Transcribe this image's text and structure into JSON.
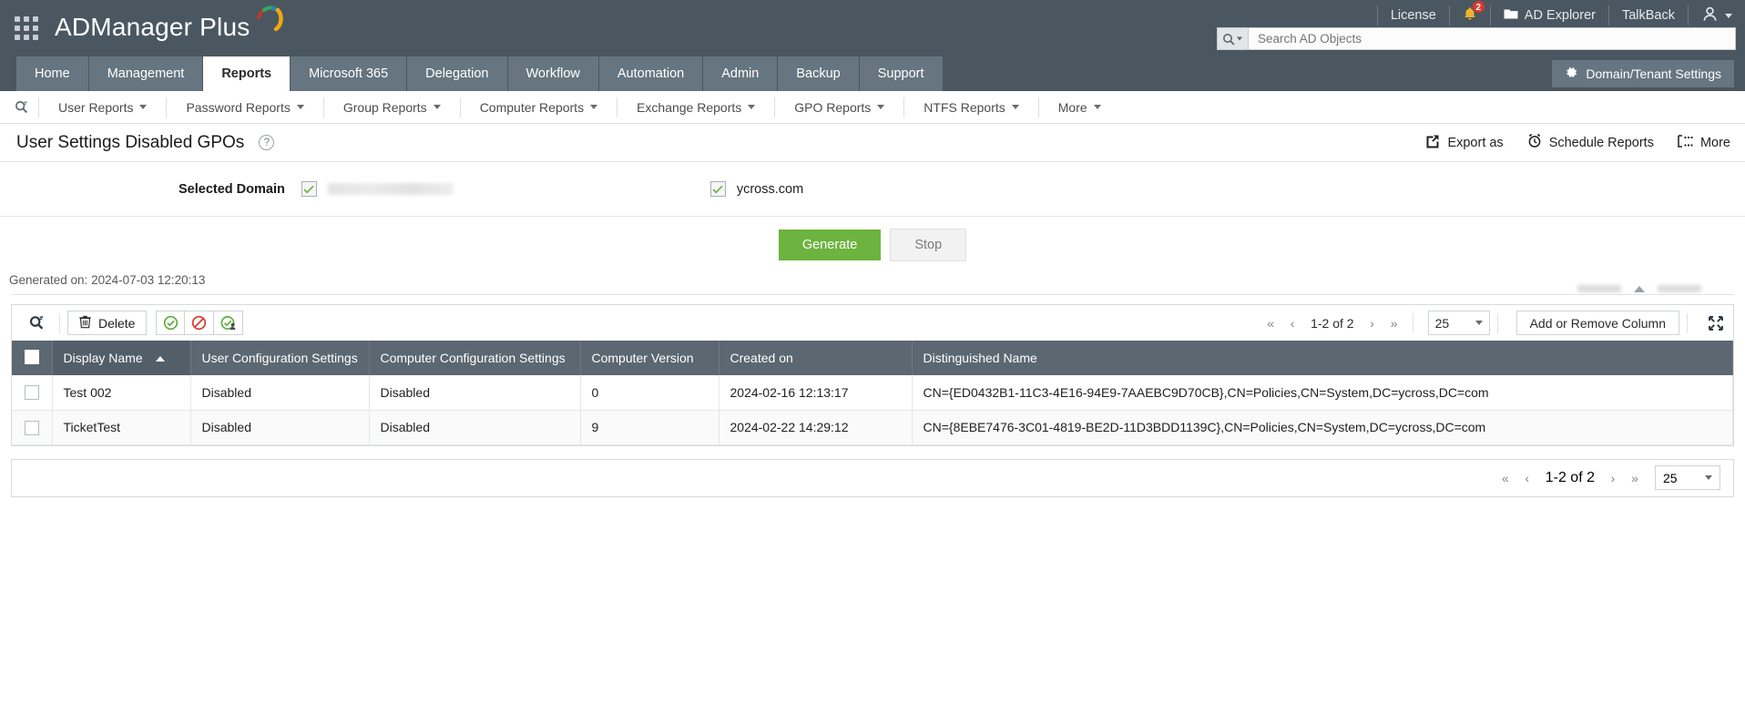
{
  "header": {
    "brand": "ADManager Plus",
    "apps_icon": "apps-grid-icon",
    "license_label": "License",
    "notification_count": "2",
    "ad_explorer_label": "AD Explorer",
    "talkback_label": "TalkBack",
    "search": {
      "placeholder": "Search AD Objects",
      "value": ""
    }
  },
  "nav": {
    "tabs": [
      {
        "label": "Home",
        "active": false
      },
      {
        "label": "Management",
        "active": false
      },
      {
        "label": "Reports",
        "active": true
      },
      {
        "label": "Microsoft 365",
        "active": false
      },
      {
        "label": "Delegation",
        "active": false
      },
      {
        "label": "Workflow",
        "active": false
      },
      {
        "label": "Automation",
        "active": false
      },
      {
        "label": "Admin",
        "active": false
      },
      {
        "label": "Backup",
        "active": false
      },
      {
        "label": "Support",
        "active": false
      }
    ],
    "domain_tenant_settings": "Domain/Tenant Settings"
  },
  "subnav": {
    "items": [
      {
        "label": "User Reports"
      },
      {
        "label": "Password Reports"
      },
      {
        "label": "Group Reports"
      },
      {
        "label": "Computer Reports"
      },
      {
        "label": "Exchange Reports"
      },
      {
        "label": "GPO Reports"
      },
      {
        "label": "NTFS Reports"
      },
      {
        "label": "More"
      }
    ]
  },
  "page": {
    "title": "User Settings Disabled GPOs",
    "help": "?",
    "actions": {
      "export_as": "Export as",
      "schedule_reports": "Schedule Reports",
      "more": "More"
    }
  },
  "domain_selector": {
    "label": "Selected Domain",
    "domains": [
      {
        "name": "",
        "redacted": true,
        "checked": true
      },
      {
        "name": "ycross.com",
        "redacted": false,
        "checked": true
      }
    ]
  },
  "actions": {
    "generate": "Generate",
    "stop": "Stop"
  },
  "generated_on": "Generated on: 2024-07-03 12:20:13",
  "toolbar": {
    "delete_label": "Delete",
    "add_remove_column": "Add or Remove Column",
    "page_size": "25",
    "page_range": "1-2 of 2"
  },
  "bottom_toolbar": {
    "page_range": "1-2 of 2",
    "page_size": "25"
  },
  "table": {
    "columns": [
      {
        "label": "Display Name",
        "sorted": true,
        "sort_dir": "asc"
      },
      {
        "label": "User Configuration Settings",
        "sorted": false
      },
      {
        "label": "Computer Configuration Settings",
        "sorted": false
      },
      {
        "label": "Computer Version",
        "sorted": false
      },
      {
        "label": "Created on",
        "sorted": false
      },
      {
        "label": "Distinguished Name",
        "sorted": false
      }
    ],
    "rows": [
      {
        "display_name": "Test 002",
        "user_config": "Disabled",
        "computer_config": "Disabled",
        "computer_version": "0",
        "created_on": "2024-02-16 12:13:17",
        "distinguished_name": "CN={ED0432B1-11C3-4E16-94E9-7AAEBC9D70CB},CN=Policies,CN=System,DC=ycross,DC=com"
      },
      {
        "display_name": "TicketTest",
        "user_config": "Disabled",
        "computer_config": "Disabled",
        "computer_version": "9",
        "created_on": "2024-02-22 14:29:12",
        "distinguished_name": "CN={8EBE7476-3C01-4819-BE2D-11D3BDD1139C},CN=Policies,CN=System,DC=ycross,DC=com"
      }
    ]
  },
  "colors": {
    "header_bg": "#4a5761",
    "tab_bg": "#66757f",
    "generate_green": "#6cb33f",
    "table_header": "#5b6771",
    "badge_red": "#d9382c"
  }
}
